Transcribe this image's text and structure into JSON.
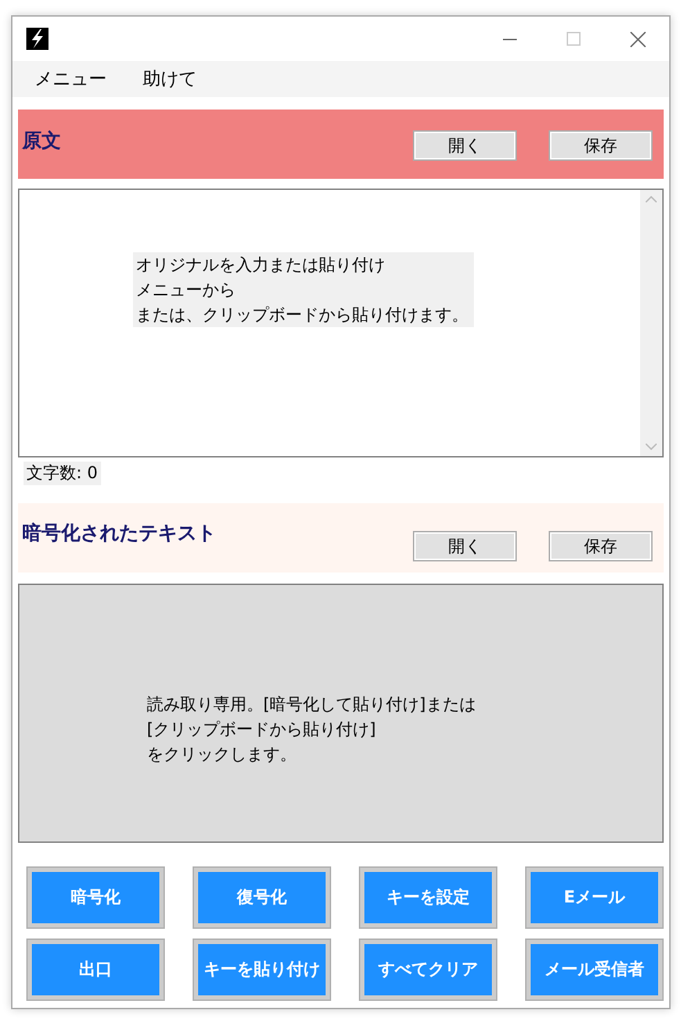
{
  "menu": [
    "メニュー",
    "助けて"
  ],
  "source": {
    "title": "原文",
    "buttons": [
      "開く",
      "保存"
    ],
    "placeholder_lines": [
      "オリジナルを入力または貼り付け",
      "メニューから",
      "または、クリップボードから貼り付けます。"
    ],
    "char_count": "文字数: 0"
  },
  "encrypted": {
    "title": "暗号化されたテキスト",
    "buttons": [
      "開く",
      "保存"
    ],
    "placeholder_lines": [
      "読み取り専用。[暗号化して貼り付け]または",
      "[クリップボードから貼り付け]",
      "をクリックします。"
    ]
  },
  "actions": [
    "暗号化",
    "復号化",
    "キーを設定",
    "Eメール",
    "出口",
    "キーを貼り付け",
    "すべてクリア",
    "メール受信者"
  ]
}
